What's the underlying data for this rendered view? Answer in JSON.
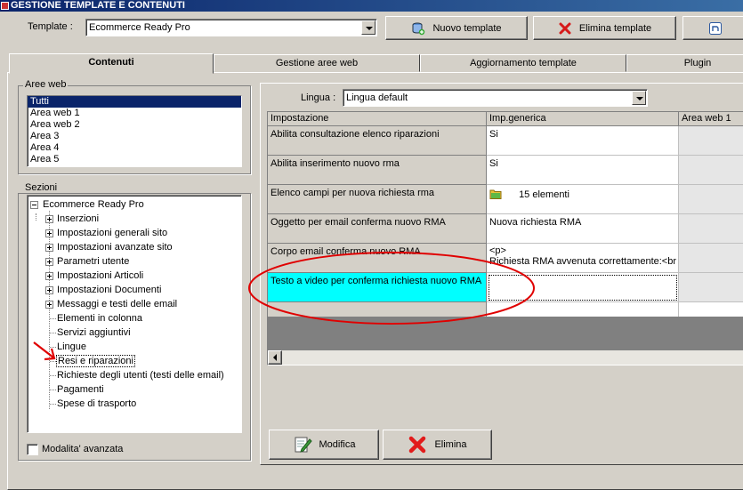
{
  "window": {
    "title": "GESTIONE TEMPLATE E CONTENUTI"
  },
  "toolbar": {
    "template_label": "Template :",
    "template_value": "Ecommerce Ready Pro",
    "new_template": "Nuovo template",
    "delete_template": "Elimina template"
  },
  "tabs": [
    "Contenuti",
    "Gestione aree web",
    "Aggiornamento template",
    "Plugin"
  ],
  "aree_web": {
    "title": "Aree web",
    "items": [
      "Tutti",
      "Area web 1",
      "Area web 2",
      "Area 3",
      "Area 4",
      "Area 5"
    ],
    "selected": "Tutti"
  },
  "sezioni": {
    "title": "Sezioni",
    "root": "Ecommerce Ready Pro",
    "items": [
      {
        "label": "Inserzioni",
        "expandable": true
      },
      {
        "label": "Impostazioni generali sito",
        "expandable": true
      },
      {
        "label": "Impostazioni avanzate sito",
        "expandable": true
      },
      {
        "label": "Parametri utente",
        "expandable": true
      },
      {
        "label": "Impostazioni Articoli",
        "expandable": true
      },
      {
        "label": "Impostazioni Documenti",
        "expandable": true
      },
      {
        "label": "Messaggi e testi delle email",
        "expandable": true
      },
      {
        "label": "Elementi in colonna",
        "expandable": false
      },
      {
        "label": "Servizi aggiuntivi",
        "expandable": false
      },
      {
        "label": "Lingue",
        "expandable": false
      },
      {
        "label": "Resi e riparazioni",
        "expandable": false
      },
      {
        "label": "Richieste degli utenti (testi delle email)",
        "expandable": false
      },
      {
        "label": "Pagamenti",
        "expandable": false
      },
      {
        "label": "Spese di trasporto",
        "expandable": false
      }
    ],
    "selected": "Resi e riparazioni"
  },
  "advanced_mode": {
    "label": "Modalita' avanzata",
    "checked": false
  },
  "lingua": {
    "label": "Lingua :",
    "value": "Lingua default"
  },
  "grid": {
    "headers": [
      "Impostazione",
      "Imp.generica",
      "Area web 1"
    ],
    "rows": [
      {
        "setting": "Abilita consultazione elenco riparazioni",
        "generic": "Si"
      },
      {
        "setting": "Abilita inserimento nuovo rma",
        "generic": "Si"
      },
      {
        "setting": "Elenco campi per nuova richiesta rma",
        "generic": "15 elementi",
        "icon": "folder-icon"
      },
      {
        "setting": "Oggetto per email conferma nuovo RMA",
        "generic": "Nuova richiesta RMA"
      },
      {
        "setting": "Corpo email conferma nuovo RMA",
        "generic_line1": "<p>",
        "generic_line2": "Richiesta RMA avvenuta correttamente:<br"
      },
      {
        "setting": "Testo a video per conferma richiesta nuovo RMA",
        "generic": "",
        "highlighted": true
      }
    ]
  },
  "actions": {
    "modify": "Modifica",
    "delete": "Elimina"
  },
  "colors": {
    "selection": "#0a246a",
    "highlight_row": "#00ffff",
    "annotation": "#e00000"
  }
}
